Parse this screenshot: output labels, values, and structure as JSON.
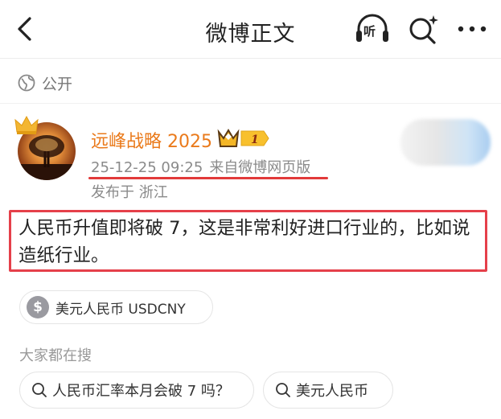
{
  "nav": {
    "title": "微博正文",
    "listen_label": "听",
    "back_icon": "chevron-left-icon",
    "listen_icon": "headphones-icon",
    "search_icon": "search-sparkle-icon",
    "more_icon": "more-dots-icon"
  },
  "visibility": {
    "label": "公开",
    "icon": "globe-icon"
  },
  "author": {
    "name": "远峰战略 2025",
    "vip_level": "1",
    "timestamp": "25-12-25 09:25",
    "source": "来自微博网页版",
    "location": "发布于 浙江",
    "name_color": "#ea7a1b"
  },
  "post": {
    "text": "人民币升值即将破 7，这是非常利好进口行业的，比如说造纸行业。",
    "highlight_color": "#e5404a"
  },
  "tag": {
    "icon_glyph": "$",
    "label": "美元人民币 USDCNY"
  },
  "searching": {
    "title": "大家都在搜",
    "items": [
      {
        "label": "人民币汇率本月会破 7 吗？"
      },
      {
        "label": "美元人民币"
      }
    ]
  }
}
